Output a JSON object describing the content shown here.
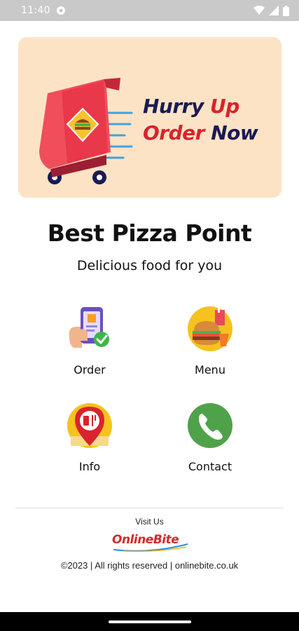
{
  "status_bar": {
    "time": "11:40",
    "icons": [
      "gear-icon",
      "wifi-icon",
      "signal-icon",
      "battery-icon"
    ]
  },
  "banner": {
    "line1_word1": "Hurry",
    "line1_word2": "Up",
    "line2_word1": "Order",
    "line2_word2": "Now",
    "colors": {
      "background": "#fde3c5",
      "navy": "#1a1a54",
      "red": "#d9232d"
    }
  },
  "header": {
    "title": "Best Pizza Point",
    "subtitle": "Delicious food for you"
  },
  "tiles": [
    {
      "label": "Order",
      "icon": "phone-order-icon"
    },
    {
      "label": "Menu",
      "icon": "burger-drink-icon"
    },
    {
      "label": "Info",
      "icon": "location-pin-icon"
    },
    {
      "label": "Contact",
      "icon": "phone-call-icon"
    }
  ],
  "footer": {
    "visit_label": "Visit Us",
    "logo_text": "OnlineBite",
    "copyright": "©2023 | All rights reserved | onlinebite.co.uk"
  }
}
